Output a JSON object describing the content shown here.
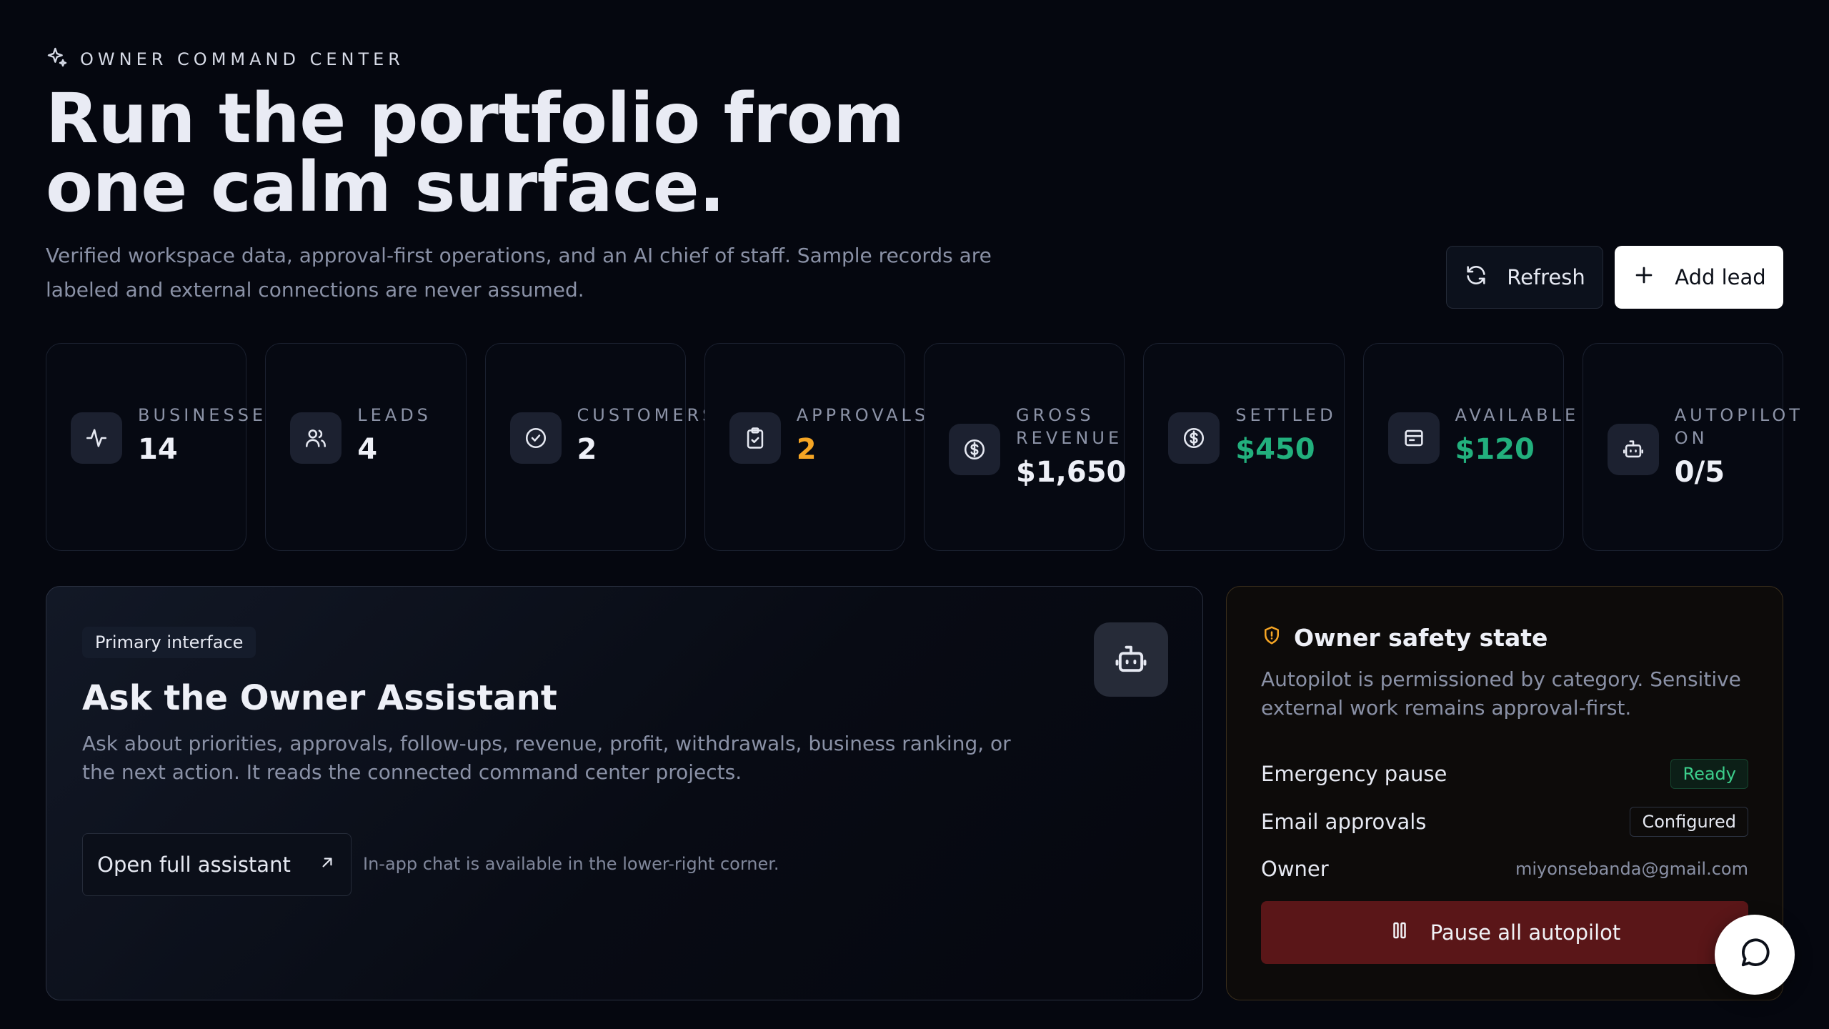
{
  "header": {
    "eyebrow": "OWNER COMMAND CENTER",
    "eyebrow_icon": "sparkles-icon",
    "title_line1": "Run the portfolio from",
    "title_line2": "one calm surface.",
    "subtitle": "Verified workspace data, approval-first operations, and an AI chief of staff. Sample records are labeled and external connections are never assumed."
  },
  "actions": {
    "refresh_label": "Refresh",
    "refresh_icon": "refresh-icon",
    "add_label": "Add lead",
    "add_icon": "plus-icon"
  },
  "stats": [
    {
      "label": "BUSINESSES",
      "value": "14",
      "icon": "activity-icon",
      "color": "#eef0f7"
    },
    {
      "label": "LEADS",
      "value": "4",
      "icon": "users-icon",
      "color": "#eef0f7"
    },
    {
      "label": "CUSTOMERS",
      "value": "2",
      "icon": "check-circle-icon",
      "color": "#eef0f7"
    },
    {
      "label": "APPROVALS",
      "value": "2",
      "icon": "clipboard-check-icon",
      "color": "#f5a524"
    },
    {
      "label": "GROSS REVENUE",
      "value": "$1,650",
      "icon": "dollar-circle-icon",
      "color": "#eef0f7"
    },
    {
      "label": "SETTLED",
      "value": "$450",
      "icon": "dollar-circle-icon",
      "color": "#22b07d"
    },
    {
      "label": "AVAILABLE",
      "value": "$120",
      "icon": "wallet-icon",
      "color": "#22b07d"
    },
    {
      "label": "AUTOPILOT ON",
      "value": "0/5",
      "icon": "bot-icon",
      "color": "#eef0f7"
    }
  ],
  "assistant": {
    "pill": "Primary interface",
    "title": "Ask the Owner Assistant",
    "description": "Ask about priorities, approvals, follow-ups, revenue, profit, withdrawals, business ranking, or the next action. It reads the connected command center projects.",
    "open_label": "Open full assistant",
    "hint": "In-app chat is available in the lower-right corner."
  },
  "safety": {
    "title": "Owner safety state",
    "description": "Autopilot is permissioned by category. Sensitive external work remains approval-first.",
    "emergency_label": "Emergency pause",
    "emergency_status": "Ready",
    "email_label": "Email approvals",
    "email_status": "Configured",
    "owner_label": "Owner",
    "owner_email": "miyonsebanda@gmail.com",
    "pause_label": "Pause all autopilot"
  },
  "colors": {
    "background": "#05070f",
    "accent_orange": "#f5a524",
    "accent_green": "#22b07d",
    "danger": "#5a1618"
  }
}
